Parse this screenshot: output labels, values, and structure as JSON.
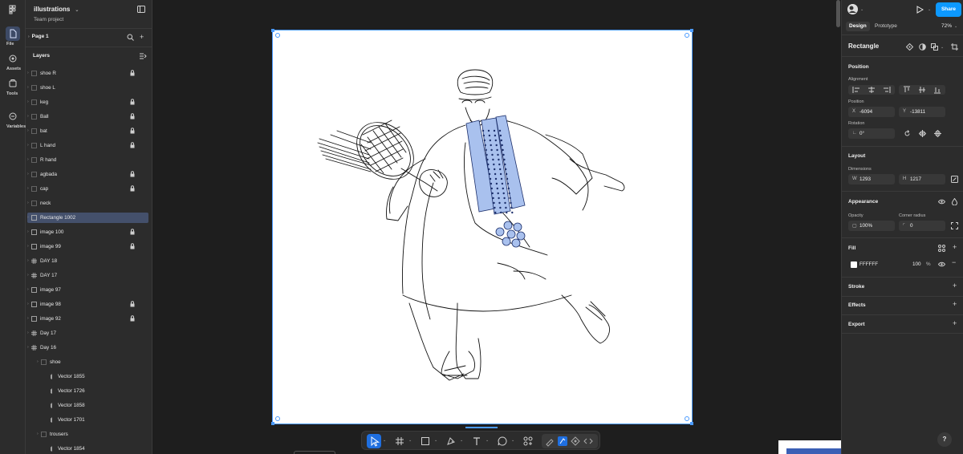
{
  "rail": {
    "items": [
      {
        "label": "File"
      },
      {
        "label": "Assets"
      },
      {
        "label": "Tools"
      },
      {
        "label": "Variables"
      }
    ]
  },
  "file": {
    "title": "illustrations",
    "subtitle": "Team project",
    "page": "Page 1"
  },
  "layers": {
    "header": "Layers",
    "rows": [
      {
        "name": "shoe R",
        "locked": true
      },
      {
        "name": "shoe L",
        "locked": false
      },
      {
        "name": "keg",
        "locked": true
      },
      {
        "name": "Ball",
        "locked": true
      },
      {
        "name": "bat",
        "locked": true
      },
      {
        "name": "L hand",
        "locked": true
      },
      {
        "name": "R hand",
        "locked": false
      },
      {
        "name": "agbada",
        "locked": true
      },
      {
        "name": "cap",
        "locked": true
      },
      {
        "name": "neck",
        "locked": false
      },
      {
        "name": "Rectangle 1002",
        "locked": false,
        "selected": true
      },
      {
        "name": "image 100",
        "locked": true
      },
      {
        "name": "image 99",
        "locked": true
      },
      {
        "name": "DAY 18",
        "locked": false
      },
      {
        "name": "DAY 17",
        "locked": false
      },
      {
        "name": "image 97",
        "locked": false
      },
      {
        "name": "image 98",
        "locked": true
      },
      {
        "name": "image 92",
        "locked": true
      },
      {
        "name": "Day 17",
        "locked": false
      },
      {
        "name": "Day 16",
        "locked": false
      },
      {
        "name": "shoe",
        "locked": false
      },
      {
        "name": "Vector 1855",
        "locked": false
      },
      {
        "name": "Vector 1726",
        "locked": false
      },
      {
        "name": "Vector 1858",
        "locked": false
      },
      {
        "name": "Vector 1701",
        "locked": false
      },
      {
        "name": "trousers",
        "locked": false
      },
      {
        "name": "Vector 1854",
        "locked": false
      }
    ]
  },
  "header_right": {
    "share": "Share",
    "tabs": [
      "Design",
      "Prototype"
    ],
    "zoom": "72%"
  },
  "props": {
    "title": "Rectangle",
    "position_section": "Position",
    "alignment_label": "Alignment",
    "position_label": "Position",
    "x_key": "X",
    "x_value": "-6094",
    "y_key": "Y",
    "y_value": "-13811",
    "rotation_label": "Rotation",
    "rotation_value": "0°",
    "layout_section": "Layout",
    "dimensions_label": "Dimensions",
    "w_key": "W",
    "w_value": "1293",
    "h_key": "H",
    "h_value": "1217",
    "appearance_section": "Appearance",
    "opacity_label": "Opacity",
    "opacity_value": "100%",
    "corner_label": "Corner radius",
    "corner_value": "0",
    "fill_section": "Fill",
    "fill_hex": "FFFFFF",
    "fill_opacity": "100",
    "fill_pct": "%",
    "stroke_section": "Stroke",
    "effects_section": "Effects",
    "export_section": "Export"
  },
  "help": "?",
  "colors": {
    "accent": "#0d99ff",
    "selection": "#4b9bff",
    "panel": "#2c2c2c",
    "canvas": "#1e1e1e"
  }
}
